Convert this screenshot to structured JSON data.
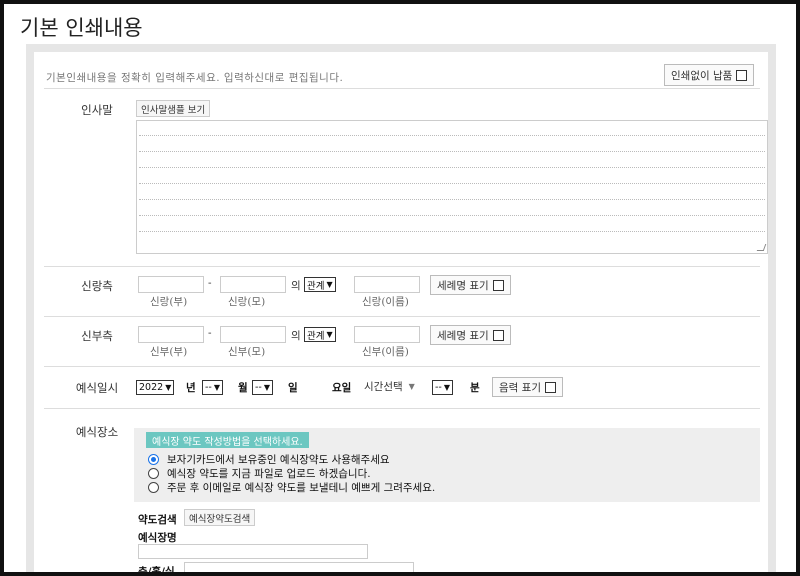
{
  "page": {
    "title": "기본 인쇄내용"
  },
  "notice": "기본인쇄내용을 정확히 입력해주세요. 입력하신대로 편집됩니다.",
  "no_print_label": "인쇄없이 납품",
  "greeting": {
    "label": "인사말",
    "view_button": "인사말샘플 보기",
    "text_value": ""
  },
  "groom": {
    "label": "신랑측",
    "dash": "-",
    "of": "의",
    "relation_select": "관계",
    "father_caption": "신랑(부)",
    "mother_caption": "신랑(모)",
    "name_caption": "신랑(이름)",
    "baptism_label": "세례명 표기"
  },
  "bride": {
    "label": "신부측",
    "dash": "-",
    "of": "의",
    "relation_select": "관계",
    "father_caption": "신부(부)",
    "mother_caption": "신부(모)",
    "name_caption": "신부(이름)",
    "baptism_label": "세례명 표기"
  },
  "datetime": {
    "label": "예식일시",
    "year": "2022",
    "year_unit": "년",
    "month": "--",
    "month_unit": "월",
    "day": "--",
    "day_unit": "일",
    "weekday_label": "요일",
    "time_select": "시간선택",
    "minute": "--",
    "minute_unit": "분",
    "lunar_label": "음력 표기"
  },
  "venue": {
    "label": "예식장소",
    "badge": "예식장 약도 작성방법을 선택하세요.",
    "options": [
      "보자기카드에서 보유중인 예식장약도 사용해주세요",
      "예식장 약도를 지금 파일로 업로드 하겠습니다.",
      "주문 후 이메일로 예식장 약도를 보낼테니 예쁘게 그려주세요."
    ],
    "selected_index": 0,
    "map_search_label": "약도검색",
    "map_search_button": "예식장약도검색",
    "venue_name_label": "예식장명",
    "venue_name_value": "",
    "floor_label": "층/홀/실",
    "floor_value": ""
  },
  "colors": {
    "accent": "#6cc7c1",
    "radio": "#1a73e8",
    "border": "#e6e6e6"
  }
}
